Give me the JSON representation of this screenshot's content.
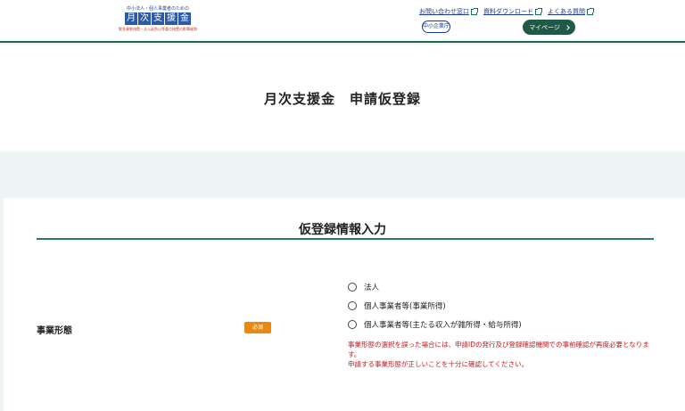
{
  "header": {
    "logo_top": "中小法人・個人事業者のための",
    "logo_chars": [
      "月",
      "次",
      "支",
      "援",
      "金"
    ],
    "logo_bottom": "緊急事態措置・まん延防止等重点措置の影響緩和",
    "links": [
      {
        "label": "お問い合わせ窓口",
        "icon": "external-link-icon"
      },
      {
        "label": "資料ダウンロード",
        "icon": "external-link-icon"
      },
      {
        "label": "よくある質問",
        "icon": "external-link-icon"
      }
    ],
    "agency_logo": "中小企業庁",
    "mypage_label": "マイページ",
    "mypage_icon": "chevron-right-icon"
  },
  "page": {
    "title": "月次支援金　申請仮登録"
  },
  "form": {
    "section_title": "仮登録情報入力",
    "field_label": "事業形態",
    "required_label": "必須",
    "options": [
      "法人",
      "個人事業者等(事業所得)",
      "個人事業者等(主たる収入が雑所得・給与所得)"
    ],
    "note_lines": [
      "事業形態の選択を誤った場合には、申請IDの発行及び登録確認機関での事前確認が再度必要となります。",
      "申請する事業形態が正しいことを十分に確認してください。"
    ]
  },
  "colors": {
    "brand_green": "#1e6b52",
    "badge_orange": "#e98a0f",
    "warning_red": "#c8171e",
    "logo_blue": "#2a5aa8"
  }
}
